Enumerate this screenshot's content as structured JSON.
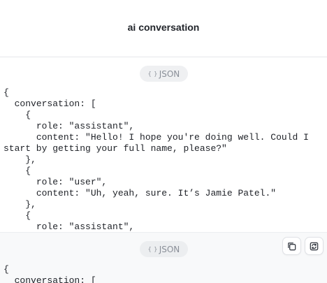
{
  "header": {
    "title": "ai conversation"
  },
  "messages": [
    {
      "badge": {
        "icon": "braces-icon",
        "label": "JSON"
      },
      "code_lines": [
        "{",
        "  conversation: [",
        "    {",
        "      role: \"assistant\",",
        "      content: \"Hello! I hope you're doing well. Could I start by getting your full name, please?\"",
        "    },",
        "    {",
        "      role: \"user\",",
        "      content: \"Uh, yeah, sure. It’s Jamie Patel.\"",
        "    },",
        "    {",
        "      role: \"assistant\","
      ]
    },
    {
      "badge": {
        "icon": "braces-icon",
        "label": "JSON"
      },
      "actions": [
        {
          "name": "copy",
          "icon": "copy-icon"
        },
        {
          "name": "regenerate",
          "icon": "refresh-icon"
        }
      ],
      "code_lines": [
        "{",
        "  conversation: ["
      ]
    }
  ]
}
